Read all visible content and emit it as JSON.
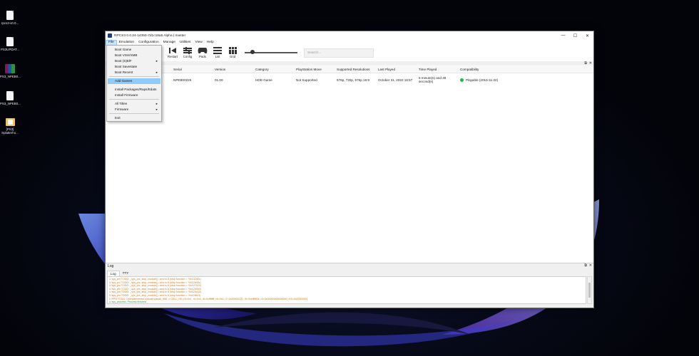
{
  "desktop": {
    "icons": [
      {
        "label": "rpcs3-v0.0...",
        "kind": "doc"
      },
      {
        "label": "PS3UPDAT...",
        "kind": "doc"
      },
      {
        "label": "PS3_NPEB0...",
        "kind": "rar"
      },
      {
        "label": "PS3_NPEB0...",
        "kind": "doc"
      },
      {
        "label": "[PS3] Splatterho...",
        "kind": "folder"
      }
    ]
  },
  "window": {
    "title": "RPCS3 0.0.24-14350-7d1c18a5 Alpha | master",
    "controls": {
      "minimize": "—",
      "maximize": "☐",
      "close": "✕"
    }
  },
  "menubar": [
    "File",
    "Emulation",
    "Configuration",
    "Manage",
    "Utilities",
    "View",
    "Help"
  ],
  "toolbar": {
    "buttons": [
      {
        "label": "Restart",
        "icon": "restart-icon"
      },
      {
        "label": "Config",
        "icon": "config-icon"
      },
      {
        "label": "Pads",
        "icon": "gamepad-icon"
      },
      {
        "label": "List",
        "icon": "list-icon"
      },
      {
        "label": "Grid",
        "icon": "grid-icon"
      }
    ],
    "search_placeholder": "Search...",
    "icon_size_slider": 0.15
  },
  "game_list": {
    "columns": [
      "Serial",
      "Version",
      "Category",
      "PlayStation Move",
      "Supported Resolutions",
      "Last Played",
      "Time Played",
      "Compatibility"
    ],
    "rows": [
      {
        "serial": "NPEB00226",
        "version": "01.00",
        "category": "HDD Game",
        "move": "Not Supported",
        "resolutions": "576p, 720p, 576p 16:9",
        "last_played": "October 31, 2022 16:57",
        "time_played": "6 minute(s) and 49 second(s)",
        "compatibility": "Playable (2016-11-22)",
        "compat_color": "#1eb64a"
      }
    ]
  },
  "file_menu": {
    "items": [
      {
        "label": "Boot Game"
      },
      {
        "label": "Boot VSH/XMB"
      },
      {
        "label": "Boot (S)ElF",
        "submenu": true
      },
      {
        "label": "Boot Savestate"
      },
      {
        "label": "Boot Recent",
        "submenu": true
      },
      {
        "label": "Add Games",
        "highlighted": true
      },
      {
        "label": "Install Packages/Raps/Edats"
      },
      {
        "label": "Install Firmware"
      },
      {
        "label": "All Titles",
        "submenu": true
      },
      {
        "label": "Firmware",
        "submenu": true
      },
      {
        "label": "Exit"
      }
    ],
    "submenu_arrow": "▸"
  },
  "log": {
    "title": "Log",
    "tabs": [
      "Log",
      "TTY"
    ],
    "lines": [
      {
        "text": "U sys_prx TODO: _sys_prx_stop_module(): cmd is 8 (stop function = *0x132d0c)",
        "color": "#d17a1a"
      },
      {
        "text": "U sys_prx TODO: _sys_prx_stop_module(): cmd is 8 (stop function = *0x12b05c)",
        "color": "#d17a1a"
      },
      {
        "text": "U sys_prx TODO: _sys_prx_stop_module(): cmd is 8 (stop function = *0x127020)",
        "color": "#d17a1a"
      },
      {
        "text": "U sys_prx TODO: _sys_prx_stop_module(): cmd is 8 (stop function = *0x1250b0)",
        "color": "#d17a1a"
      },
      {
        "text": "U sys_prx TODO: _sys_prx_stop_module(): cmd is 8 (stop function = *0x125d30)",
        "color": "#d17a1a"
      },
      {
        "text": "U sys_prx TODO: _sys_prx_stop_module(): cmd is 8 (stop function = *0x12f814)",
        "color": "#d17a1a"
      },
      {
        "text": "U PPU TODO: Unimplemented syscall syscall_988 -> CELL_OK (r3=0x1, r4=0x0, r5=0xffffffff, r6=0x0, r7=0x30000220, r8=0xeffff608, r9=0x00000000000000, r10=0x1000000)",
        "color": "#d17a1a"
      },
      {
        "text": "U sys_process: Process finished",
        "color": "#2e9e3e"
      },
      {
        "text": "E SYS: Stat: '_/sys_fsmutex_lock' failed with 0x80010006 : CELL_ESRCH [x1]",
        "color": "#c62828"
      }
    ]
  }
}
